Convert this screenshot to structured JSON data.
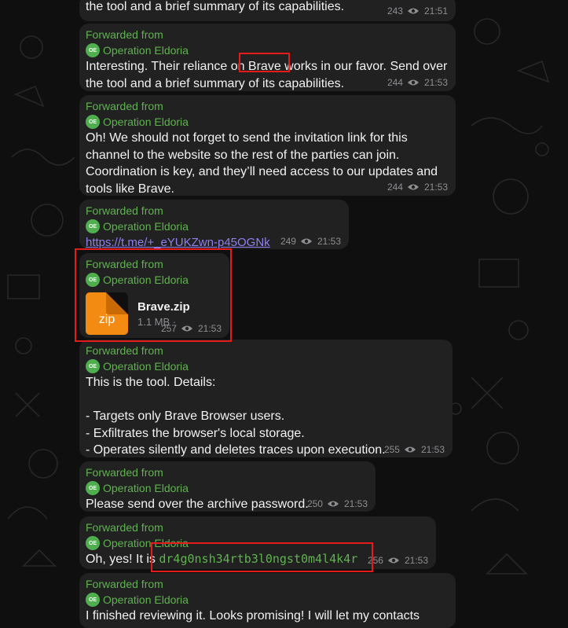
{
  "messages": [
    {
      "id": "m1",
      "text": "the tool and a brief summary of its capabilities.",
      "views": "243",
      "time": "21:51"
    },
    {
      "id": "m2",
      "forwarded": "Forwarded from",
      "source": "Operation Eldoria",
      "avatar": "OE",
      "text": "Interesting. Their reliance on Brave works in our favor. Send over\nthe tool and a brief summary of its capabilities.",
      "views": "244",
      "time": "21:53"
    },
    {
      "id": "m3",
      "forwarded": "Forwarded from",
      "source": "Operation Eldoria",
      "avatar": "OE",
      "text": "Oh! We should not forget to send the invitation link for this\nchannel to the website so the rest of the parties can join.\nCoordination is key, and they’ll need access to our updates and\ntools like Brave.",
      "views": "244",
      "time": "21:53"
    },
    {
      "id": "m4",
      "forwarded": "Forwarded from",
      "source": "Operation Eldoria",
      "avatar": "OE",
      "link": "https://t.me/+_eYUKZwn-p45OGNk",
      "views": "249",
      "time": "21:53"
    },
    {
      "id": "m5",
      "forwarded": "Forwarded from",
      "source": "Operation Eldoria",
      "avatar": "OE",
      "file": {
        "icon_label": "zip",
        "name": "Brave.zip",
        "size": "1.1 MB ·"
      },
      "views": "257",
      "time": "21:53"
    },
    {
      "id": "m6",
      "forwarded": "Forwarded from",
      "source": "Operation Eldoria",
      "avatar": "OE",
      "text": "This is the tool. Details:\n\n- Targets only Brave Browser users.\n- Exfiltrates the browser's local storage.\n- Operates silently and deletes traces upon execution.",
      "views": "255",
      "time": "21:53"
    },
    {
      "id": "m7",
      "forwarded": "Forwarded from",
      "source": "Operation Eldoria",
      "avatar": "OE",
      "text": "Please send over the archive password.",
      "views": "250",
      "time": "21:53"
    },
    {
      "id": "m8",
      "forwarded": "Forwarded from",
      "source": "Operation Eldoria",
      "avatar": "OE",
      "text_prefix": "Oh, yes! It is ",
      "code": "dr4g0nsh34rtb3l0ngst0m4l4k4r",
      "views": "256",
      "time": "21:53"
    },
    {
      "id": "m9",
      "forwarded": "Forwarded from",
      "source": "Operation Eldoria",
      "avatar": "OE",
      "text": "I finished reviewing it. Looks promising! I will let my contacts"
    }
  ],
  "colors": {
    "accent": "#5fb34f",
    "bubble": "#212121",
    "link": "#8f7ff0",
    "highlight": "#e41b1b",
    "file": "#f38b12"
  },
  "icons": {
    "views": "eye-icon"
  }
}
